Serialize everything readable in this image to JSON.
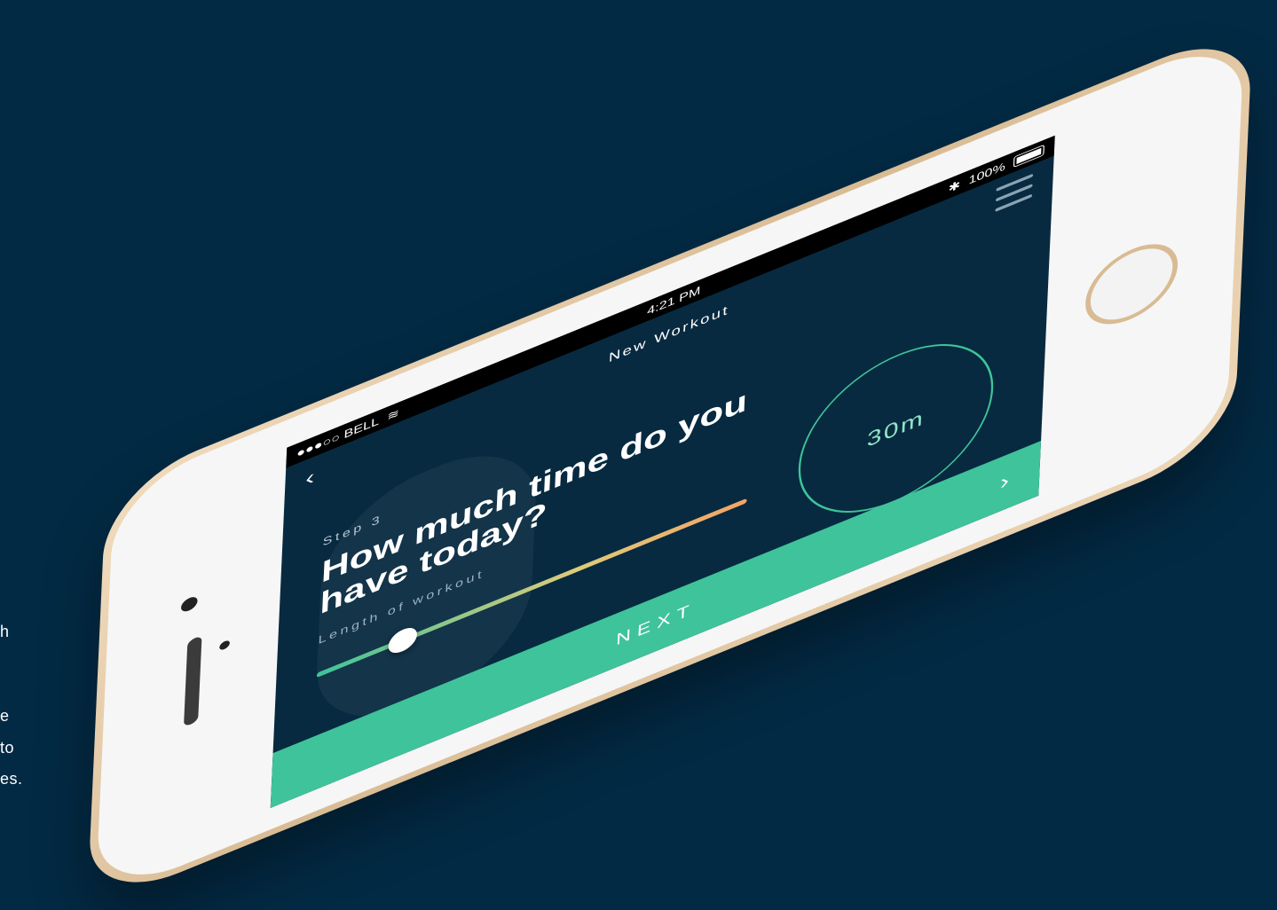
{
  "page_side_text": [
    "h",
    "e",
    "to",
    "es."
  ],
  "status_bar": {
    "carrier": "●●●○○ BELL",
    "time": "4:21 PM",
    "battery": "100%"
  },
  "nav": {
    "title": "New Workout"
  },
  "content": {
    "step": "Step 3",
    "headline": "How much time do you have today?",
    "length_label": "Length of workout",
    "duration": "30m",
    "slider_level": 0.18
  },
  "footer": {
    "next_label": "NEXT"
  },
  "colors": {
    "background": "#032a44",
    "screen": "#072a40",
    "accent": "#3fc39a",
    "slider_end": "#f6a365"
  }
}
